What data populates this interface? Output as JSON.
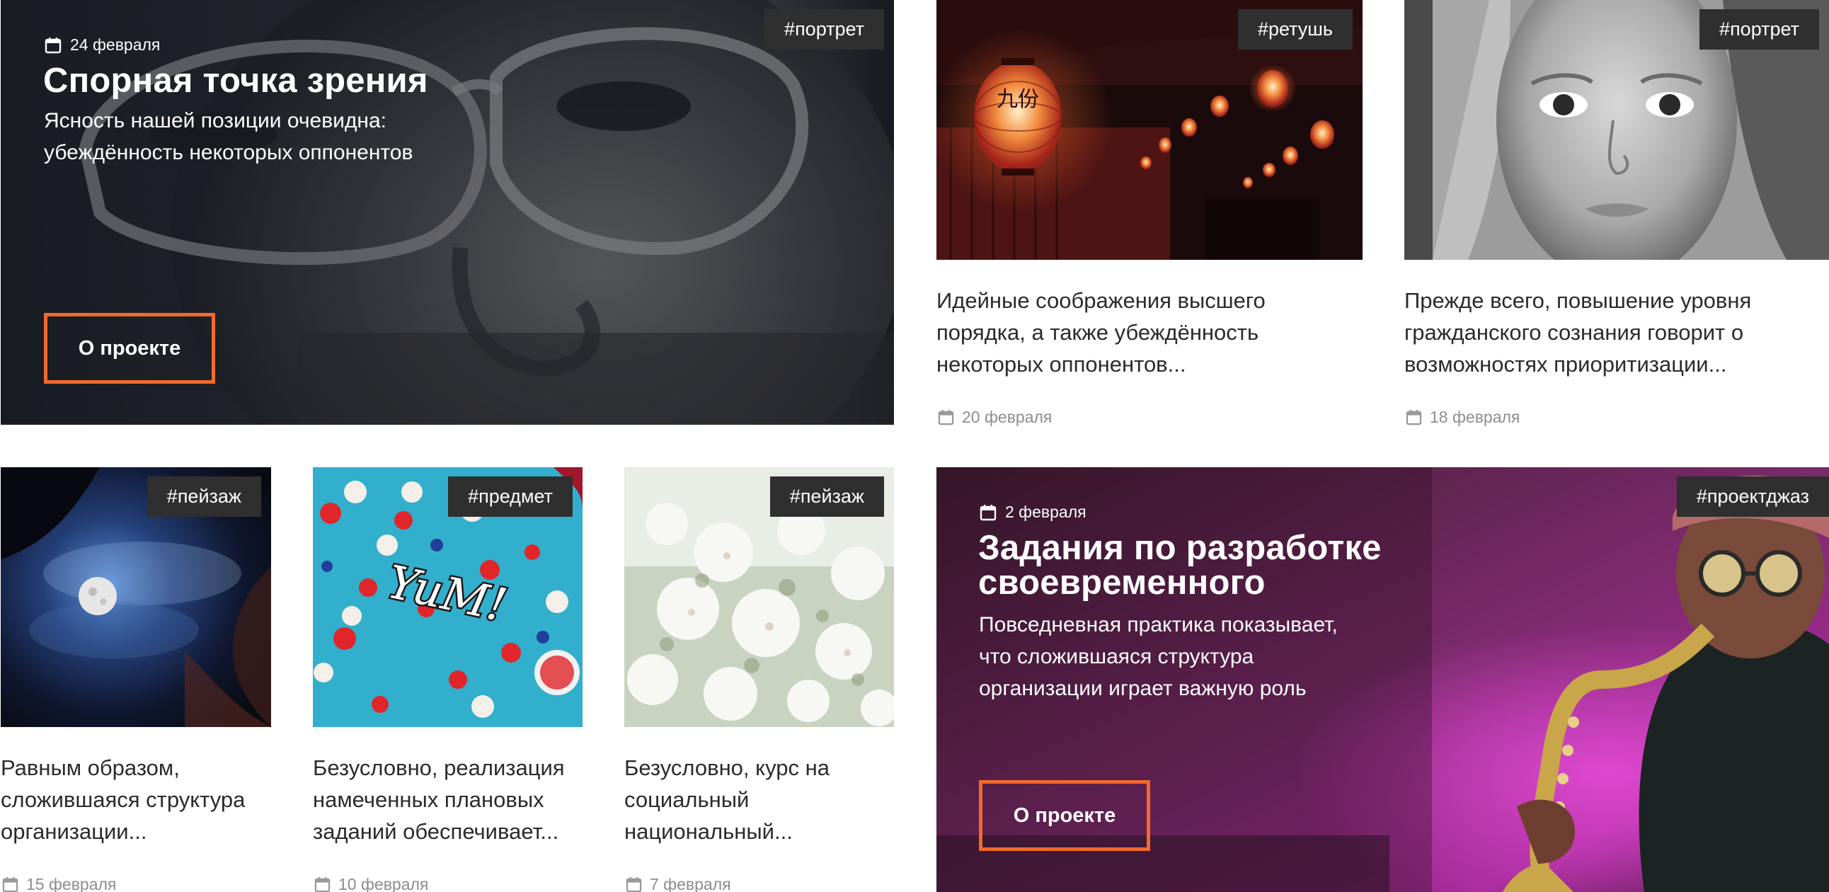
{
  "colors": {
    "accent": "#f2692b",
    "tag_bg": "#2f2f2f",
    "meta_text": "#8d8d8d",
    "body_text": "#2b2b2b"
  },
  "featured": [
    {
      "tag": "#портрет",
      "date": "24 февраля",
      "title": "Спорная точка зрения",
      "text_lines": [
        "Ясность нашей позиции очевидна:",
        "убеждённость некоторых оппонентов"
      ],
      "button": "О проекте",
      "icon": "calendar-icon"
    },
    {
      "tag": "#проектджаз",
      "date": "2 февраля",
      "title_lines": [
        "Задания по разработке",
        "своевременного"
      ],
      "text_lines": [
        "Повседневная практика показывает,",
        "что сложившаяся структура",
        "организации играет важную роль"
      ],
      "button": "О проекте",
      "icon": "calendar-icon"
    }
  ],
  "posts": [
    {
      "tag": "#ретушь",
      "excerpt_lines": [
        "Идейные соображения высшего",
        "порядка, а также убеждённость",
        "некоторых оппонентов..."
      ],
      "date": "20 февраля"
    },
    {
      "tag": "#портрет",
      "excerpt_lines": [
        "Прежде всего, повышение уровня",
        "гражданского сознания говорит о",
        "возможностях приоритизации..."
      ],
      "date": "18 февраля"
    },
    {
      "tag": "#пейзаж",
      "excerpt_lines": [
        "Равным образом,",
        "сложившаяся структура",
        "организации..."
      ],
      "date": "15 февраля"
    },
    {
      "tag": "#предмет",
      "excerpt_lines": [
        "Безусловно, реализация",
        "намеченных плановых",
        "заданий обеспечивает..."
      ],
      "date": "10 февраля"
    },
    {
      "tag": "#пейзаж",
      "excerpt_lines": [
        "Безусловно, курс на",
        "социальный",
        "национальный..."
      ],
      "date": "7 февраля"
    }
  ],
  "image_labels": {
    "lantern_text": "九份",
    "candy_text": "YuM!"
  }
}
